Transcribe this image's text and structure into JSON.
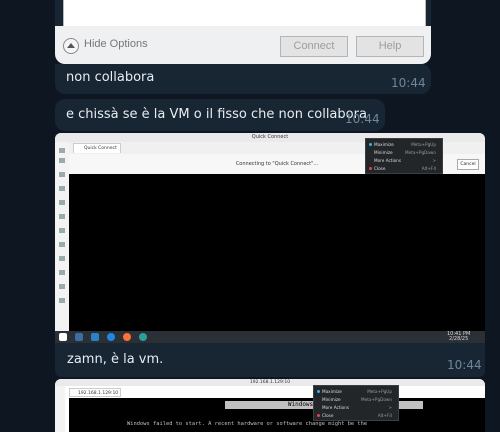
{
  "dialog": {
    "hide_options_label": "Hide Options",
    "connect_label": "Connect",
    "help_label": "Help"
  },
  "messages": [
    {
      "text": "non collabora",
      "time": "10:44"
    },
    {
      "text": "e chissà se è la VM o il fisso che non collabora",
      "time": "10:44"
    },
    {
      "text": "zamn, è la vm.",
      "time": "10:44"
    }
  ],
  "screenshot1": {
    "window_title": "Quick Connect",
    "tab_label": "Quick Connect",
    "connecting_text": "Connecting to \"Quick Connect\"...",
    "cancel_label": "Cancel",
    "menu": [
      {
        "label": "Maximize",
        "key": "Meta+PgUp"
      },
      {
        "label": "Minimize",
        "key": "Meta+PgDown"
      },
      {
        "label": "More Actions",
        "key": ">"
      },
      {
        "label": "Close",
        "key": "Alt+F4"
      }
    ],
    "clock_time": "10:41 PM",
    "clock_date": "2/28/25"
  },
  "screenshot2": {
    "window_title": "192.168.1.129:10",
    "tab_label": "192.168.1.129:10",
    "boot_title": "Windows Boot Manager",
    "boot_message": "Windows failed to start. A recent hardware or software change might be the",
    "menu": [
      {
        "label": "Maximize",
        "key": "Meta+PgUp"
      },
      {
        "label": "Minimize",
        "key": "Meta+PgDown"
      },
      {
        "label": "More Actions",
        "key": ">"
      },
      {
        "label": "Close",
        "key": "Alt+F4"
      }
    ]
  },
  "colors": {
    "background": "#0e1621",
    "bubble": "#182533",
    "time": "#6f8799"
  }
}
